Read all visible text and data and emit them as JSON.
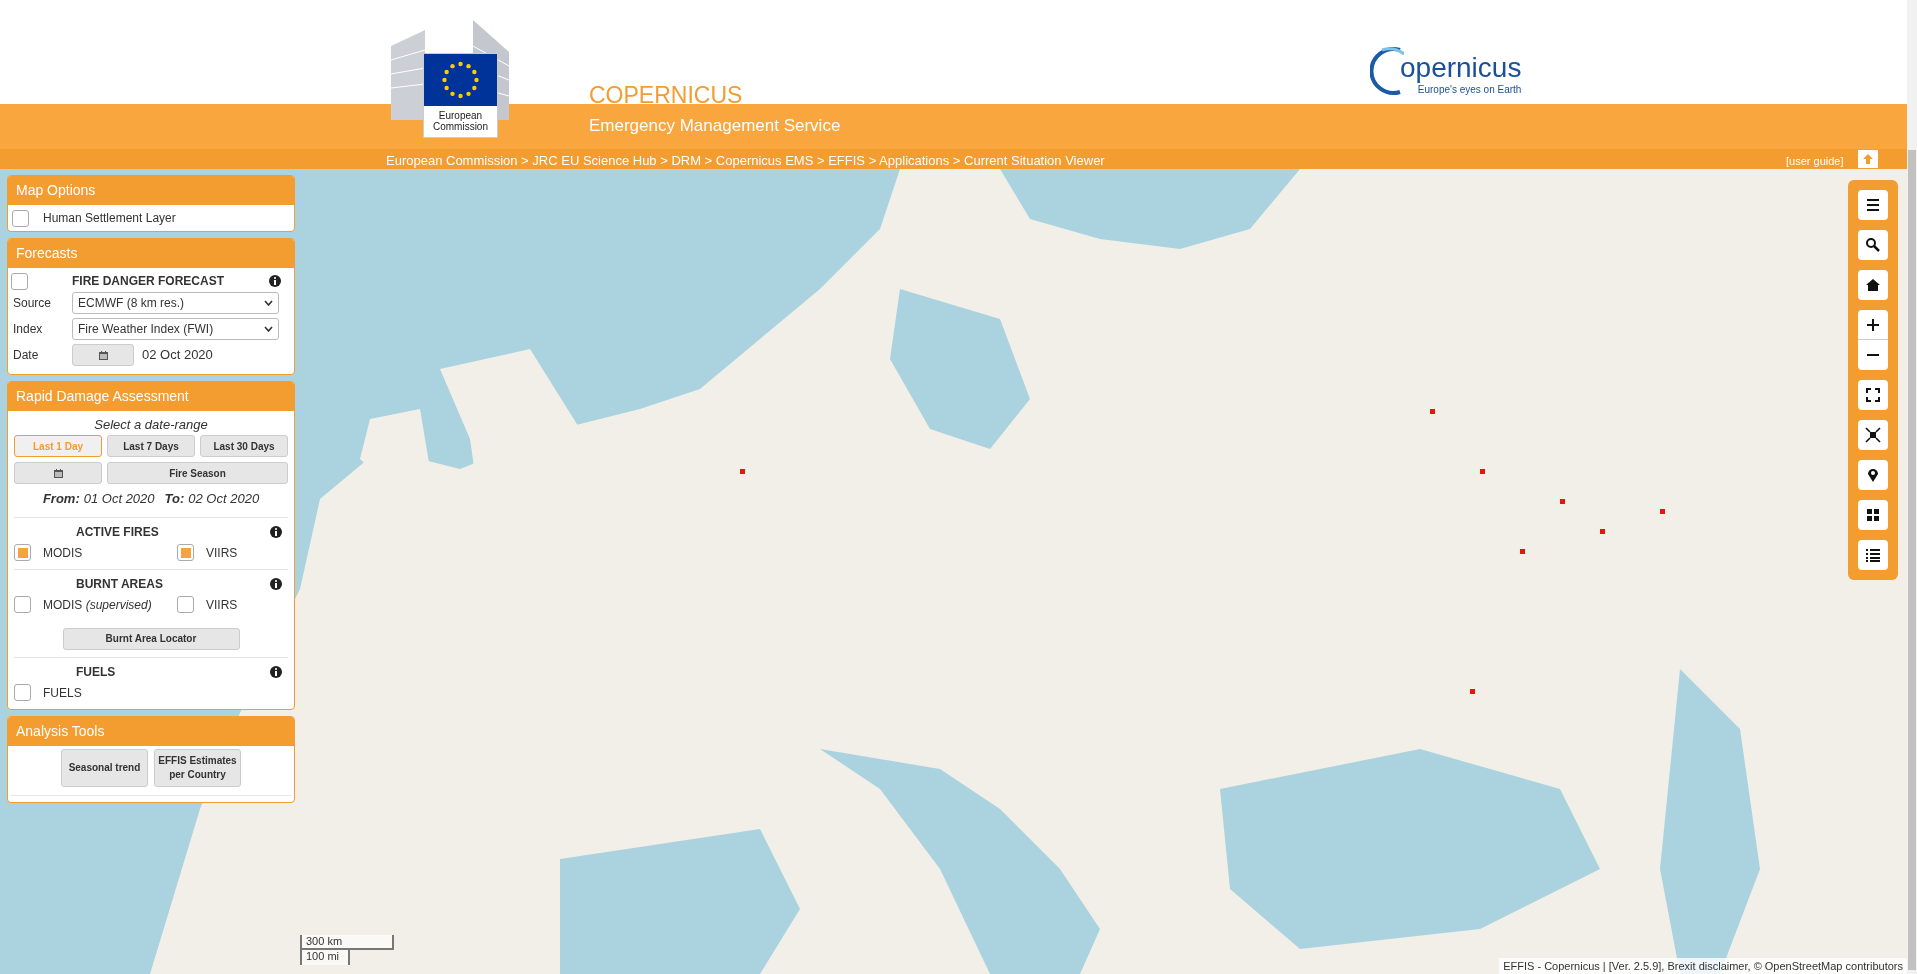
{
  "header": {
    "ec_logo_caption": "European Commission",
    "title": "COPERNICUS",
    "subtitle": "Emergency Management Service",
    "copernicus_logo_word": "opernicus",
    "copernicus_tagline": "Europe's eyes on Earth"
  },
  "breadcrumb": "European Commission > JRC EU Science Hub > DRM > Copernicus EMS > EFFIS > Applications > Current Situation Viewer",
  "user_guide": "[user guide]",
  "map_options": {
    "title": "Map Options",
    "items": [
      {
        "label": "Human Settlement Layer",
        "checked": false
      }
    ]
  },
  "forecasts": {
    "title": "Forecasts",
    "heading": "FIRE DANGER FORECAST",
    "checked": false,
    "source_label": "Source",
    "source_value": "ECMWF (8 km res.)",
    "index_label": "Index",
    "index_value": "Fire Weather Index (FWI)",
    "date_label": "Date",
    "date_value": "02 Oct 2020"
  },
  "rapid_damage": {
    "title": "Rapid Damage Assessment",
    "prompt": "Select a date-range",
    "ranges": [
      {
        "label": "Last 1 Day",
        "selected": true
      },
      {
        "label": "Last 7 Days",
        "selected": false
      },
      {
        "label": "Last 30 Days",
        "selected": false
      }
    ],
    "season_button": "Fire Season",
    "from_label": "From:",
    "from_value": "01 Oct 2020",
    "to_label": "To:",
    "to_value": "02 Oct 2020",
    "sections": [
      {
        "title": "ACTIVE FIRES",
        "options": [
          {
            "label": "MODIS",
            "checked": true
          },
          {
            "label": "VIIRS",
            "checked": true
          }
        ]
      },
      {
        "title": "BURNT AREAS",
        "options": [
          {
            "label": "MODIS *(supervised)*",
            "checked": false
          },
          {
            "label": "VIIRS",
            "checked": false
          }
        ],
        "button": "Burnt Area Locator"
      },
      {
        "title": "FUELS",
        "options": [
          {
            "label": "FUELS",
            "checked": false
          }
        ]
      }
    ]
  },
  "analysis_tools": {
    "title": "Analysis Tools",
    "buttons": [
      "Seasonal trend",
      "EFFIS Estimates per Country"
    ]
  },
  "map": {
    "scale_km": "300 km",
    "scale_mi": "100 mi",
    "attribution": "EFFIS - Copernicus | [Ver. 2.5.9], Brexit disclaimer, © OpenStreetMap contributors"
  }
}
